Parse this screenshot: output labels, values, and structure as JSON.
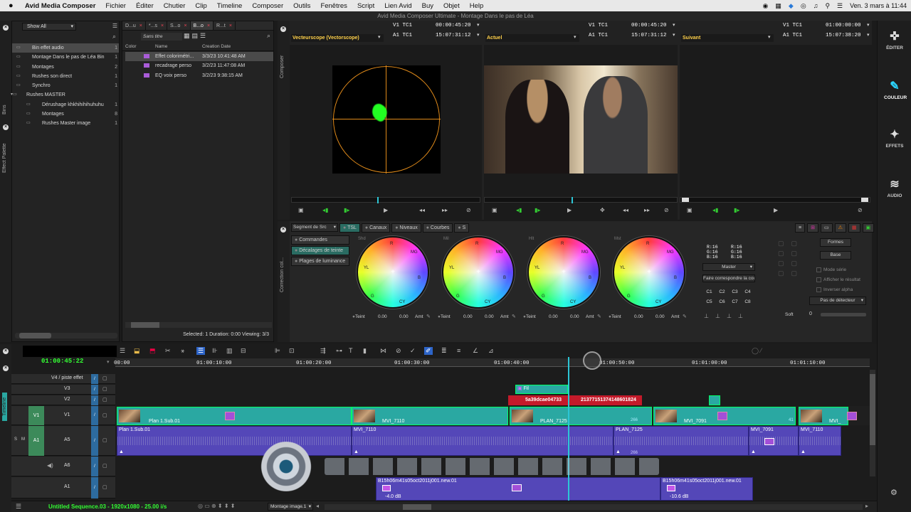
{
  "menubar": {
    "apple": "",
    "app": "Avid Media Composer",
    "items": [
      "Fichier",
      "Éditer",
      "Chutier",
      "Clip",
      "Timeline",
      "Composer",
      "Outils",
      "Fenêtres",
      "Script",
      "Lien Avid",
      "Buy",
      "Objet",
      "Help"
    ],
    "datetime": "Ven. 3 mars à 11:44"
  },
  "window_title": "Avid Media Composer Ultimate - Montage Dans le pas de Léa",
  "project": {
    "show_all": "Show All",
    "bins": [
      {
        "name": "Bin effet audio",
        "num": "1",
        "indent": 1,
        "selected": true
      },
      {
        "name": "Montage Dans le pas de Léa Bin",
        "num": "1",
        "indent": 1
      },
      {
        "name": "Montages",
        "num": "2",
        "indent": 1
      },
      {
        "name": "Rushes son direct",
        "num": "1",
        "indent": 1
      },
      {
        "name": "Synchro",
        "num": "1",
        "indent": 1
      },
      {
        "name": "Rushes MASTER",
        "num": "",
        "indent": 0,
        "folder": true
      },
      {
        "name": "Dérushage khkhihihihuhuhu",
        "num": "1",
        "indent": 2
      },
      {
        "name": "Montages",
        "num": "8",
        "indent": 2
      },
      {
        "name": "Rushes Master image",
        "num": "1",
        "indent": 2
      }
    ],
    "side_tabs": [
      "Bins",
      "Effect Palette"
    ]
  },
  "bin": {
    "tabs": [
      {
        "label": "D...u"
      },
      {
        "label": "*...s",
        "active": false
      },
      {
        "label": "S...o"
      },
      {
        "label": "B...o",
        "active": true
      },
      {
        "label": "R...t"
      }
    ],
    "view_name": "Sans titre",
    "columns": [
      "Color",
      "Name",
      "Creation Date"
    ],
    "rows": [
      {
        "name": "Effet colorimétri...",
        "date": "3/3/23 10:41:48 AM",
        "selected": true
      },
      {
        "name": "recadrage perso",
        "date": "3/2/23 11:47:08 AM"
      },
      {
        "name": "EQ voix perso",
        "date": "3/2/23 9:38:15 AM"
      }
    ],
    "status": "Selected: 1  Duration: 0:00  Viewing: 3/3"
  },
  "composer": {
    "side_label": "Composer",
    "monitors": [
      {
        "label": "Vecteurscope (Vectorscope)",
        "v1": "V1",
        "tc1": "TC1",
        "v1_val": "00:00:45:20",
        "a1": "A1",
        "tc2": "TC1",
        "a1_val": "15:07:31:12"
      },
      {
        "label": "Actuel",
        "v1": "V1",
        "tc1": "TC1",
        "v1_val": "00:00:45:20",
        "a1": "A1",
        "tc2": "TC1",
        "a1_val": "15:07:31:12"
      },
      {
        "label": "Suivant",
        "v1": "V1",
        "tc1": "TC1",
        "v1_val": "01:00:00:00",
        "a1": "A1",
        "tc2": "TC1",
        "a1_val": "15:07:38:20"
      }
    ]
  },
  "color": {
    "side_label": "Correction col...",
    "segment": "Segment de Src",
    "tabs": [
      "TSL",
      "Canaux",
      "Niveaux",
      "Courbes",
      "S"
    ],
    "left_items": [
      "Commandes",
      "Décalages de teinte",
      "Plages de luminance"
    ],
    "wheels": [
      {
        "title": "Shd",
        "teint": "Teint",
        "v1": "0.00",
        "v2": "0.00",
        "amt": "Amt"
      },
      {
        "title": "Mil",
        "teint": "Teint",
        "v1": "0.00",
        "v2": "0.00",
        "amt": "Amt"
      },
      {
        "title": "Hlt",
        "teint": "Teint",
        "v1": "0.00",
        "v2": "0.00",
        "amt": "Amt"
      },
      {
        "title": "Mst",
        "teint": "Teint",
        "v1": "0.00",
        "v2": "0.00",
        "amt": "Amt"
      }
    ],
    "wheel_labels": {
      "r": "R",
      "mg": "MG",
      "yl": "YL",
      "b": "B",
      "g": "G",
      "cy": "CY"
    },
    "rgb_left": [
      "R:16",
      "G:16",
      "B:16"
    ],
    "rgb_right": [
      "R:16",
      "G:16",
      "B:16"
    ],
    "master": "Master",
    "match": "Faire correspondre la couleur",
    "c_buttons": [
      "C1",
      "C2",
      "C3",
      "C4",
      "C5",
      "C6",
      "C7",
      "C8"
    ],
    "formes": "Formes",
    "base": "Base",
    "checks": [
      "Mode série",
      "Afficher le résultat",
      "Inverser alpha"
    ],
    "detector": "Pas de détecteur",
    "soft": "Soft",
    "soft_val": "0"
  },
  "timeline": {
    "side_label": "Timeline",
    "current_tc": "01:00:45:22",
    "ruler": [
      "00:00",
      "01:00:10:00",
      "01:00:20:00",
      "01:00:30:00",
      "01:00:40:00",
      "01:00:50:00",
      "01:01:00:00",
      "01:01:10:00"
    ],
    "tracks": [
      {
        "name": "V4 / piste effet"
      },
      {
        "name": "V3"
      },
      {
        "name": "V2"
      },
      {
        "name": "V1",
        "src": "V1"
      },
      {
        "name": "A5",
        "src": "A1",
        "s": "S",
        "m": "M"
      },
      {
        "name": "A6"
      },
      {
        "name": "A1"
      }
    ],
    "clips_v2": [
      {
        "label": "Fil"
      },
      {
        "label": "5a39dcae04733"
      },
      {
        "label": "21377151374148601824"
      }
    ],
    "clips_v1": [
      {
        "label": "Plan 1.Sub.01"
      },
      {
        "label": "MVI_7110"
      },
      {
        "label": "PLAN_7125"
      },
      {
        "label": "MVI_7091"
      },
      {
        "label": "MVI_"
      }
    ],
    "clip_counts": [
      "266",
      "41"
    ],
    "clips_a5": [
      {
        "label": "Plan 1.Sub.01"
      },
      {
        "label": "MVI_7110"
      },
      {
        "label": "PLAN_7125"
      },
      {
        "label": "MVI_7091"
      },
      {
        "label": "MVI_7110"
      }
    ],
    "a5_count": "266",
    "clips_a1": [
      {
        "label": "B15h06m41s05oct2011j001.new.01",
        "db": "-4.0 dB"
      },
      {
        "label": "B15h06m41s05oct2011j001.new.01",
        "db": "-10.6 dB"
      }
    ],
    "sequence": "Untitled Sequence.03 - 1920x1080 - 25.00 i/s",
    "bin_select": "Montage image.1"
  },
  "rightbar": [
    {
      "label": "ÉDITER",
      "icon": "edit-icon"
    },
    {
      "label": "COULEUR",
      "icon": "color-icon"
    },
    {
      "label": "EFFETS",
      "icon": "effects-icon"
    },
    {
      "label": "AUDIO",
      "icon": "audio-icon"
    }
  ],
  "colors": {
    "accent": "#2aa8a2",
    "audio": "#5447b8",
    "playhead": "#2cc6d6"
  }
}
